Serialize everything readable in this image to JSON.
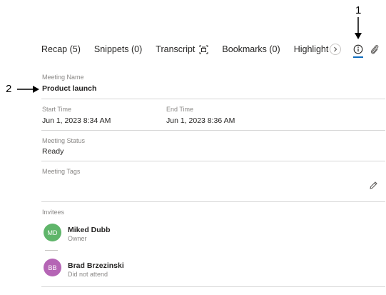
{
  "callouts": {
    "one": "1",
    "two": "2"
  },
  "tabs": [
    {
      "label": "Recap (5)"
    },
    {
      "label": "Snippets (0)"
    },
    {
      "label": "Transcript"
    },
    {
      "label": "Bookmarks (0)"
    },
    {
      "label": "Highlight"
    }
  ],
  "details": {
    "meeting_name": {
      "label": "Meeting Name",
      "value": "Product launch"
    },
    "start_time": {
      "label": "Start Time",
      "value": "Jun 1, 2023 8:34 AM"
    },
    "end_time": {
      "label": "End Time",
      "value": "Jun 1, 2023 8:36 AM"
    },
    "status": {
      "label": "Meeting Status",
      "value": "Ready"
    },
    "tags": {
      "label": "Meeting Tags"
    }
  },
  "invitees": {
    "label": "Invitees",
    "people": [
      {
        "initials": "MD",
        "name": "Miked Dubb",
        "role": "Owner"
      },
      {
        "initials": "BB",
        "name": "Brad Brzezinski",
        "role": "Did not attend"
      }
    ]
  },
  "colors": {
    "accent": "#0f6cbd",
    "avatar_md": "#5fb56a",
    "avatar_bb": "#b565b5"
  },
  "icons": {
    "info": "info-icon",
    "attach": "paperclip-icon",
    "transcript": "transcript-icon",
    "chevron": "chevron-right-icon",
    "edit": "pencil-icon",
    "arrow": "arrow-icon"
  }
}
